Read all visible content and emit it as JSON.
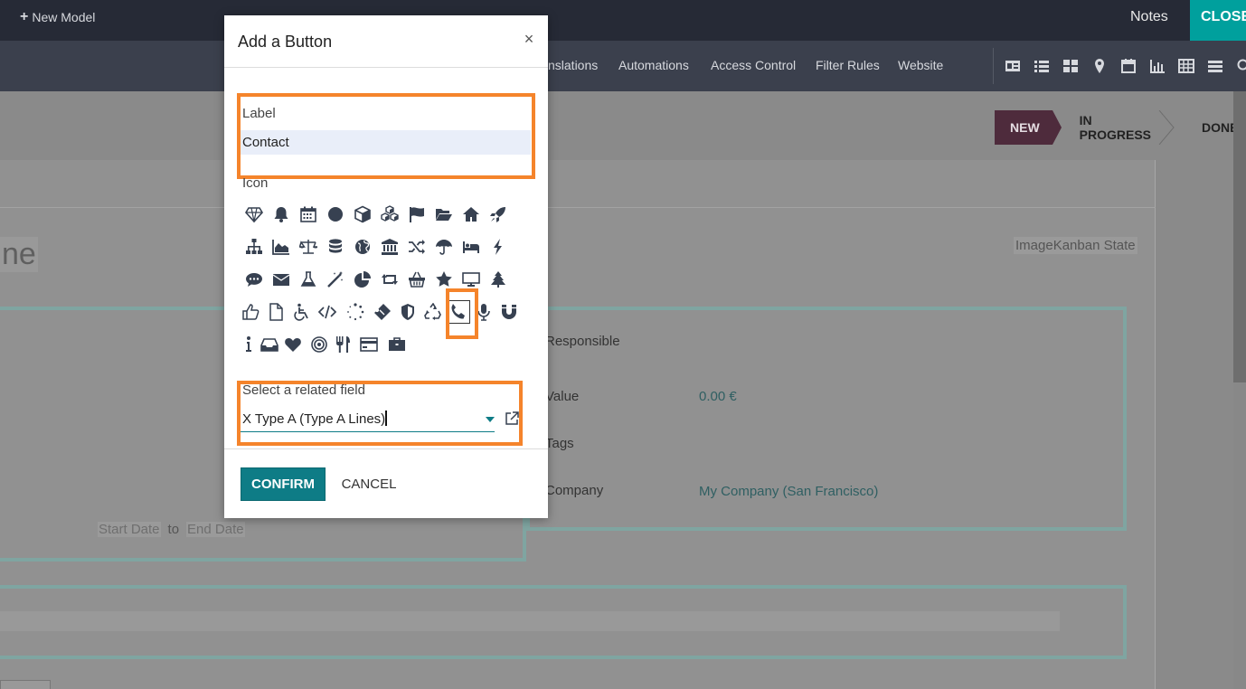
{
  "topbar": {
    "new_model_label": "New Model",
    "notes_label": "Notes",
    "close_label": "CLOSE"
  },
  "menubar": {
    "items": [
      "nslations",
      "Automations",
      "Access Control",
      "Filter Rules",
      "Website"
    ],
    "view_icons": [
      "form-view-icon",
      "list-view-icon",
      "kanban-view-icon",
      "map-view-icon",
      "calendar-view-icon",
      "graph-view-icon",
      "pivot-view-icon",
      "activity-view-icon",
      "search-icon"
    ]
  },
  "statusbar": {
    "steps": [
      "NEW",
      "IN PROGRESS",
      "DONE"
    ],
    "active": "NEW"
  },
  "form": {
    "title_fragment": "ne",
    "image_kanban_label": "ImageKanban State",
    "responsible_label": "Responsible",
    "value_label": "Value",
    "value_value": "0.00 €",
    "tags_label": "Tags",
    "company_label": "Company",
    "company_value": "My Company (San Francisco)",
    "start_date_placeholder": "Start Date",
    "date_separator": "to",
    "end_date_placeholder": "End Date"
  },
  "modal": {
    "title": "Add a Button",
    "close_symbol": "×",
    "label_caption": "Label",
    "label_value": "Contact",
    "icon_caption": "Icon",
    "icons": [
      [
        "diamond",
        "bell",
        "calendar",
        "circle",
        "cube",
        "cubes",
        "flag",
        "folder-open",
        "home",
        "rocket"
      ],
      [
        "sitemap",
        "area-chart",
        "balance-scale",
        "database",
        "globe",
        "university",
        "random",
        "umbrella",
        "bed",
        "bolt"
      ],
      [
        "comment",
        "envelope",
        "flask",
        "magic",
        "pie-chart",
        "retweet",
        "shopping-basket",
        "star",
        "television",
        "tree"
      ],
      [
        "thumbs-up",
        "file",
        "wheelchair",
        "code",
        "spinner",
        "ticket",
        "shield",
        "recycle",
        "phone",
        "microphone",
        "magnet"
      ],
      [
        "info",
        "inbox",
        "heart",
        "bullseye",
        "cutlery",
        "credit-card",
        "briefcase"
      ]
    ],
    "selected_icon": "phone",
    "related_caption": "Select a related field",
    "related_value": "X Type A (Type A  Lines)",
    "confirm_label": "CONFIRM",
    "cancel_label": "CANCEL"
  },
  "colors": {
    "topbar_bg": "#262a36",
    "menubar_bg": "#3b404d",
    "accent_teal": "#0e7c86",
    "close_bg": "#00a09d",
    "highlight_orange": "#f5842b",
    "status_active_bg": "#4e2b3c",
    "icon_color": "#374151"
  }
}
